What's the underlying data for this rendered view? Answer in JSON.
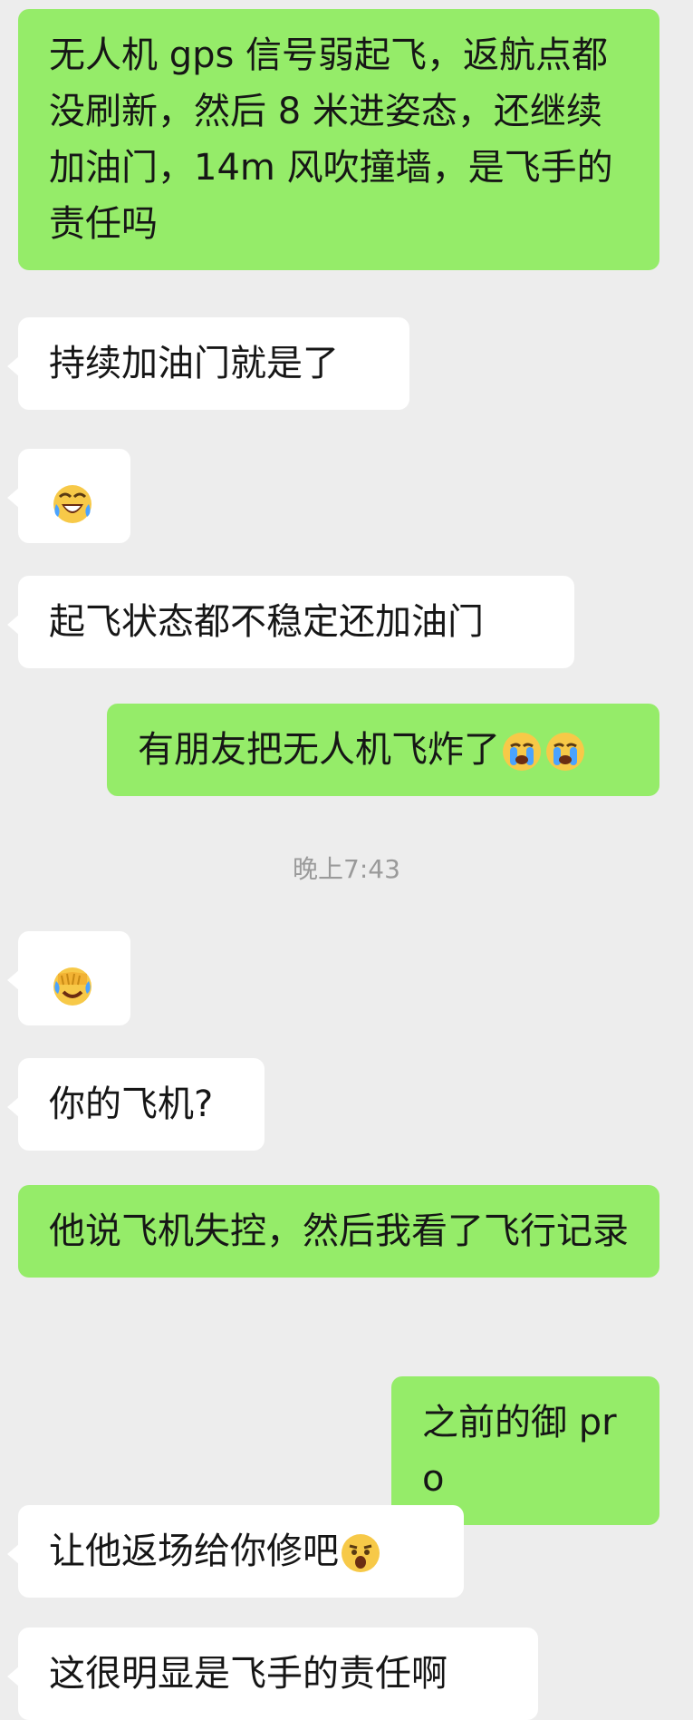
{
  "messages": {
    "m1": "无人机 gps 信号弱起飞，返航点都没刷新，然后 8 米进姿态，还继续加油门，14m 风吹撞墙，是飞手的责任吗",
    "m2": "持续加油门就是了",
    "m4": "起飞状态都不稳定还加油门",
    "m5": "有朋友把无人机飞炸了",
    "m7": "你的飞机?",
    "m8": "他说飞机失控，然后我看了飞行记录",
    "m9": "之前的御 pro",
    "m10": "让他返场给你修吧",
    "m11": "这很明显是飞手的责任啊"
  },
  "timestamp": "晚上7:43",
  "icons": {
    "laughing_tears": "tears-of-joy-emoji",
    "crying": "loudly-crying-emoji",
    "facepalm": "facepalm-emoji",
    "surprised": "hushed-face-emoji"
  },
  "colors": {
    "sent_bubble": "#95ec69",
    "received_bubble": "#ffffff",
    "background": "#ededed",
    "timestamp_text": "#9a9a9a"
  }
}
